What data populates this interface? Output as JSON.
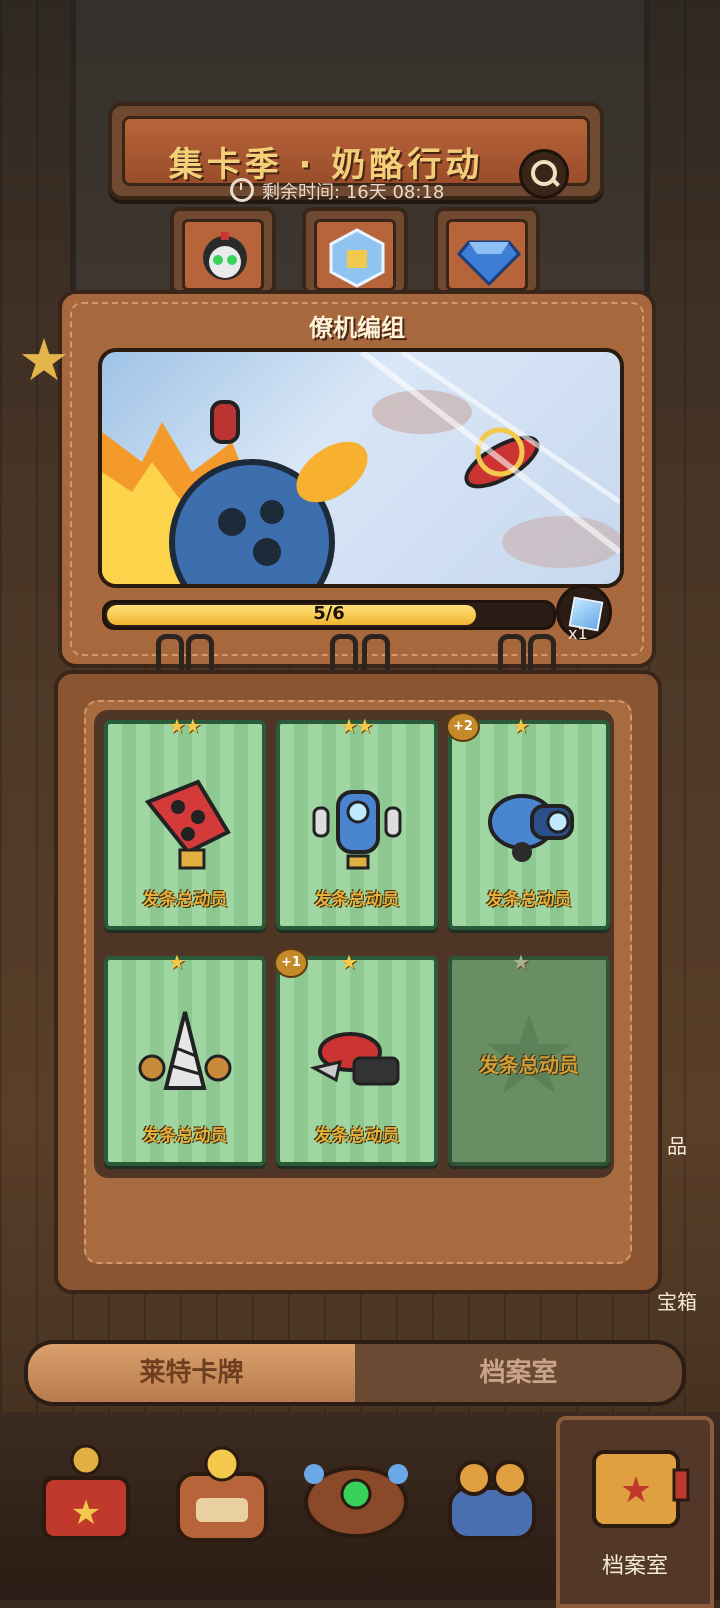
{
  "header": {
    "title": "集卡季 · 奶酪行动",
    "timer_label": "剩余时间:",
    "timer_value": "16天 08:18"
  },
  "album": {
    "title": "僚机编组",
    "progress_text": "5/6",
    "progress_fraction": 0.833,
    "reward_count": "x1"
  },
  "cards": [
    {
      "label": "发条总动员",
      "stars": "★★",
      "plus": ""
    },
    {
      "label": "发条总动员",
      "stars": "★★",
      "plus": ""
    },
    {
      "label": "发条总动员",
      "stars": "★",
      "plus": "+2"
    },
    {
      "label": "发条总动员",
      "stars": "★",
      "plus": ""
    },
    {
      "label": "发条总动员",
      "stars": "★",
      "plus": "+1"
    },
    {
      "label": "发条总动员",
      "stars": "★",
      "plus": ""
    }
  ],
  "side_buttons": {
    "partial_label": "品",
    "chest_label": "宝箱"
  },
  "tabs": {
    "left": "莱特卡牌",
    "right": "档案室"
  },
  "bottom_nav": {
    "active_label": "档案室"
  },
  "colors": {
    "accent_gold": "#f2c94c",
    "card_green": "#9fd6a2",
    "leather": "#a8683e"
  }
}
